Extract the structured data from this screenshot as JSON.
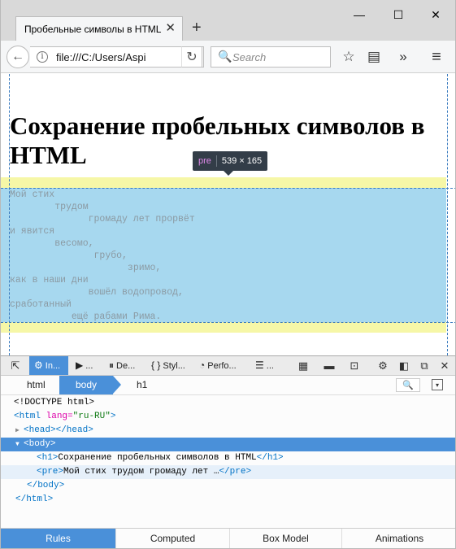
{
  "window": {
    "tab_title": "Пробельные символы в HTML",
    "tab_close": "✕",
    "new_tab": "+",
    "controls": {
      "minimize": "—",
      "maximize": "☐",
      "close": "✕"
    }
  },
  "navbar": {
    "back": "←",
    "info": "i",
    "url": "file:///C:/Users/Aspi",
    "reload": "↻",
    "search_placeholder": "Search",
    "search_icon": "🔍",
    "icons": {
      "bookmark": "☆",
      "reader": "▤",
      "overflow": "»",
      "menu": "≡"
    }
  },
  "page": {
    "heading": "Сохранение пробельных символов в HTML",
    "poem": "Мой стих\n        трудом\n              громаду лет прорвёт\nи явится\n        весомо,\n               грубо,\n                     зримо,\nкак в наши дни\n              вошёл водопровод,\nсработанный\n           ещё рабами Рима.",
    "tooltip": {
      "tag": "pre",
      "dimensions": "539 × 165"
    }
  },
  "devtools": {
    "toolbar": {
      "pick_icon": "⇱",
      "tabs": [
        {
          "icon": "⚙",
          "label": "In..."
        },
        {
          "icon": "▶",
          "label": "..."
        },
        {
          "icon": "⏸",
          "label": "De..."
        },
        {
          "icon": "{ }",
          "label": "Styl..."
        },
        {
          "icon": "◔",
          "label": "Perfo..."
        },
        {
          "icon": "☰",
          "label": "..."
        }
      ],
      "right_icons": {
        "frames": "▦",
        "responsive": "▬",
        "screenshot": "⊡",
        "settings": "⚙",
        "dock": "◧",
        "undock": "⧉",
        "close": "✕"
      }
    },
    "breadcrumbs": [
      "html",
      "body",
      "h1"
    ],
    "breadcrumb_search": "🔍",
    "breadcrumb_menu": "▾",
    "markup": {
      "doctype": "<!DOCTYPE html>",
      "html_open_tag": "<html",
      "html_attr": "lang=",
      "html_val": "\"ru-RU\"",
      "html_close_bracket": ">",
      "head": "<head></head>",
      "body_open": "<body>",
      "h1_open": "<h1>",
      "h1_text": "Сохранение пробельных символов в HTML",
      "h1_close": "</h1>",
      "pre_open": "<pre>",
      "pre_text": "Мой стих трудом громаду лет …",
      "pre_close": "</pre>",
      "body_close": "</body>",
      "html_close": "</html>"
    },
    "sidebar_tabs": [
      "Rules",
      "Computed",
      "Box Model",
      "Animations"
    ]
  },
  "colors": {
    "accent": "#4a90d9",
    "margin_highlight": "#f6f7a7",
    "content_highlight": "#a7d8ef",
    "tooltip_bg": "#333d48"
  }
}
